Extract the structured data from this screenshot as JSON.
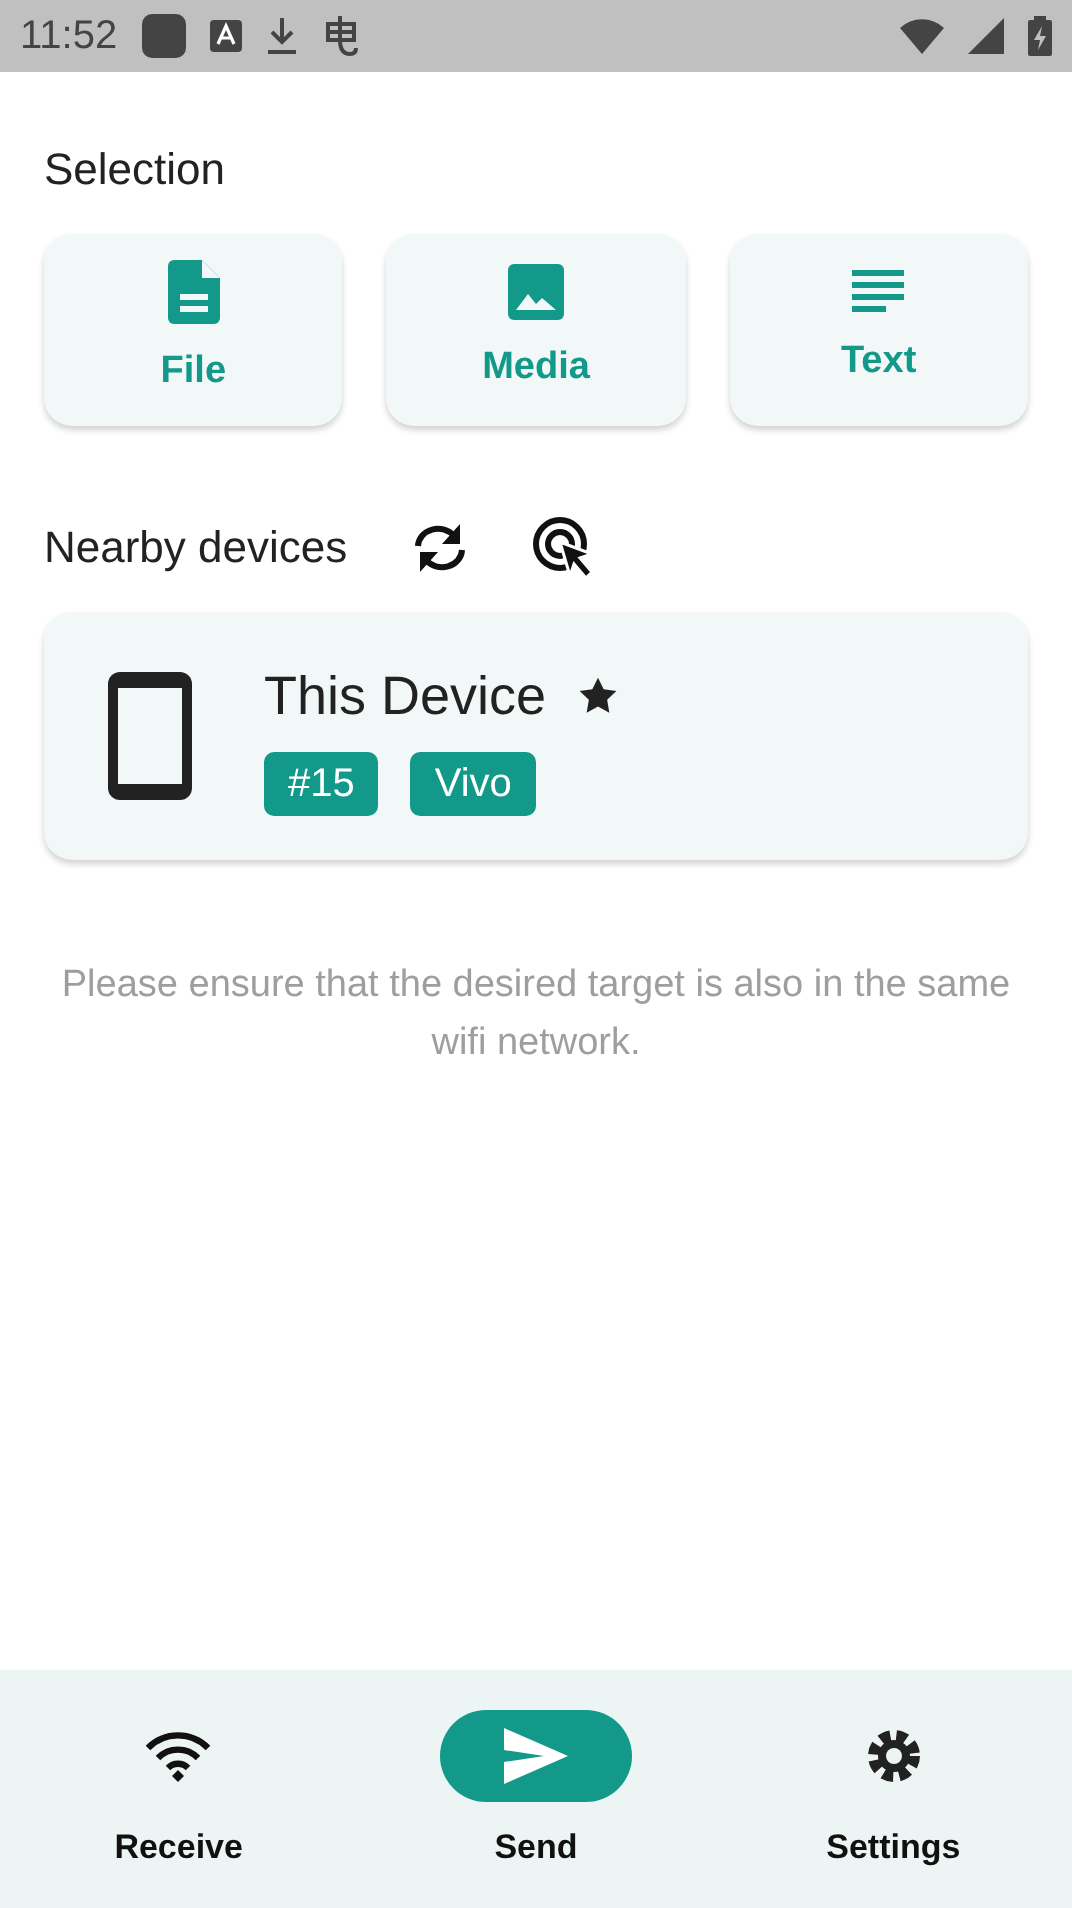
{
  "status_bar": {
    "time": "11:52"
  },
  "selection": {
    "title": "Selection",
    "options": [
      {
        "kind": "file",
        "label": "File"
      },
      {
        "kind": "media",
        "label": "Media"
      },
      {
        "kind": "text",
        "label": "Text"
      }
    ]
  },
  "nearby": {
    "title": "Nearby devices",
    "device": {
      "name": "This Device",
      "favorite": true,
      "tags": [
        "#15",
        "Vivo"
      ]
    },
    "hint": "Please ensure that the desired target is also in the same wifi network."
  },
  "nav": [
    {
      "kind": "receive",
      "label": "Receive",
      "selected": false
    },
    {
      "kind": "send",
      "label": "Send",
      "selected": true
    },
    {
      "kind": "settings",
      "label": "Settings",
      "selected": false
    }
  ]
}
